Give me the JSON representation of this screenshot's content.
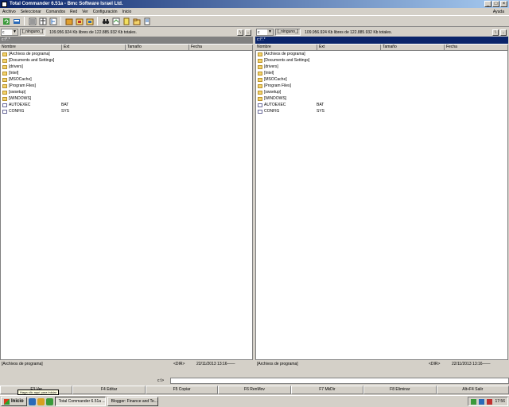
{
  "window": {
    "title": "Total Commander 6.51a - Bmc Software Israel Ltd.",
    "help_menu": "Ayuda"
  },
  "menu": [
    "Archivo",
    "Seleccionar",
    "Comandos",
    "Red",
    "Ver",
    "Configuración",
    "Inicio"
  ],
  "toolbar_icons": [
    "refresh-icon",
    "ftp-icon",
    "brief-view-icon",
    "full-view-icon",
    "tree-icon",
    "sort-name-icon",
    "sort-ext-icon",
    "sort-date-icon",
    "pack-icon",
    "unpack-icon",
    "binoculars-icon",
    "multi-rename-icon",
    "notepad-icon",
    "folder-new-icon",
    "notes-icon"
  ],
  "left_panel": {
    "drive": "c",
    "volume_label": "[_ninguno_]",
    "drive_info": "109.956.924 Kb libres de 122.885.932 Kb totales.",
    "path": "c:\\*.*",
    "columns": [
      "Nombre",
      "Ext",
      "Tamaño",
      "Fecha"
    ],
    "entries": [
      {
        "name": "[Archivos de programa]",
        "ext": "",
        "type": "folder"
      },
      {
        "name": "[Documents and Settings]",
        "ext": "",
        "type": "folder"
      },
      {
        "name": "[drivers]",
        "ext": "",
        "type": "folder"
      },
      {
        "name": "[Intel]",
        "ext": "",
        "type": "folder"
      },
      {
        "name": "[MSOCache]",
        "ext": "",
        "type": "folder"
      },
      {
        "name": "[Program Files]",
        "ext": "",
        "type": "folder"
      },
      {
        "name": "[swsetup]",
        "ext": "",
        "type": "folder"
      },
      {
        "name": "[WINDOWS]",
        "ext": "",
        "type": "folder"
      },
      {
        "name": "AUTOEXEC",
        "ext": "BAT",
        "type": "file"
      },
      {
        "name": "CONFIG",
        "ext": "SYS",
        "type": "file"
      }
    ],
    "status_name": "[Archivos de programa]",
    "status_size": "<DIR>",
    "status_date": "22/11/2013 13:16——"
  },
  "right_panel": {
    "drive": "c",
    "volume_label": "[_ninguno_]",
    "drive_info": "109.956.924 Kb libres de 122.885.932 Kb totales.",
    "path": "c:\\*.*",
    "columns": [
      "Nombre",
      "Ext",
      "Tamaño",
      "Fecha"
    ],
    "entries": [
      {
        "name": "[Archivos de programa]",
        "ext": "",
        "type": "folder"
      },
      {
        "name": "[Documents and Settings]",
        "ext": "",
        "type": "folder"
      },
      {
        "name": "[drivers]",
        "ext": "",
        "type": "folder"
      },
      {
        "name": "[Intel]",
        "ext": "",
        "type": "folder"
      },
      {
        "name": "[MSOCache]",
        "ext": "",
        "type": "folder"
      },
      {
        "name": "[Program Files]",
        "ext": "",
        "type": "folder"
      },
      {
        "name": "[swsetup]",
        "ext": "",
        "type": "folder"
      },
      {
        "name": "[WINDOWS]",
        "ext": "",
        "type": "folder"
      },
      {
        "name": "AUTOEXEC",
        "ext": "BAT",
        "type": "file"
      },
      {
        "name": "CONFIG",
        "ext": "SYS",
        "type": "file"
      }
    ],
    "status_name": "[Archivos de programa]",
    "status_size": "<DIR>",
    "status_date": "22/11/2013 13:16——"
  },
  "command_line": {
    "prompt": "c:\\>",
    "value": ""
  },
  "fkeys": [
    "F3 Ver",
    "F4 Editar",
    "F5 Copiar",
    "F6 RenMov",
    "F7 MkDir",
    "F8 Eliminar",
    "Alt+F4 Salir"
  ],
  "tooltip": "Haga clic aquí para iniciar",
  "taskbar": {
    "start_label": "Inicio",
    "tasks": [
      "Total Commander 6.51a ...",
      "Blogger: Finance and Te..."
    ],
    "clock": "17:56"
  },
  "colors": {
    "title_start": "#0a246a",
    "title_end": "#a6caf0",
    "active_path": "#0a246a",
    "inactive_path": "#808080",
    "folder": "#f3d36b"
  }
}
